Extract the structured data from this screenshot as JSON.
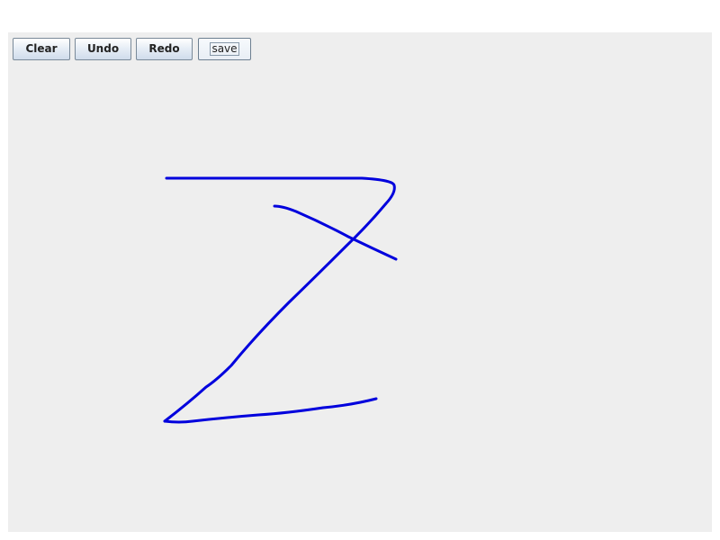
{
  "toolbar": {
    "clear_label": "Clear",
    "undo_label": "Undo",
    "redo_label": "Redo",
    "save_label": "save"
  },
  "drawing": {
    "stroke_color": "#0000dd",
    "strokes": [
      {
        "name": "top-stroke"
      },
      {
        "name": "cross-stroke"
      },
      {
        "name": "diagonal-stroke"
      },
      {
        "name": "bottom-stroke"
      }
    ]
  }
}
